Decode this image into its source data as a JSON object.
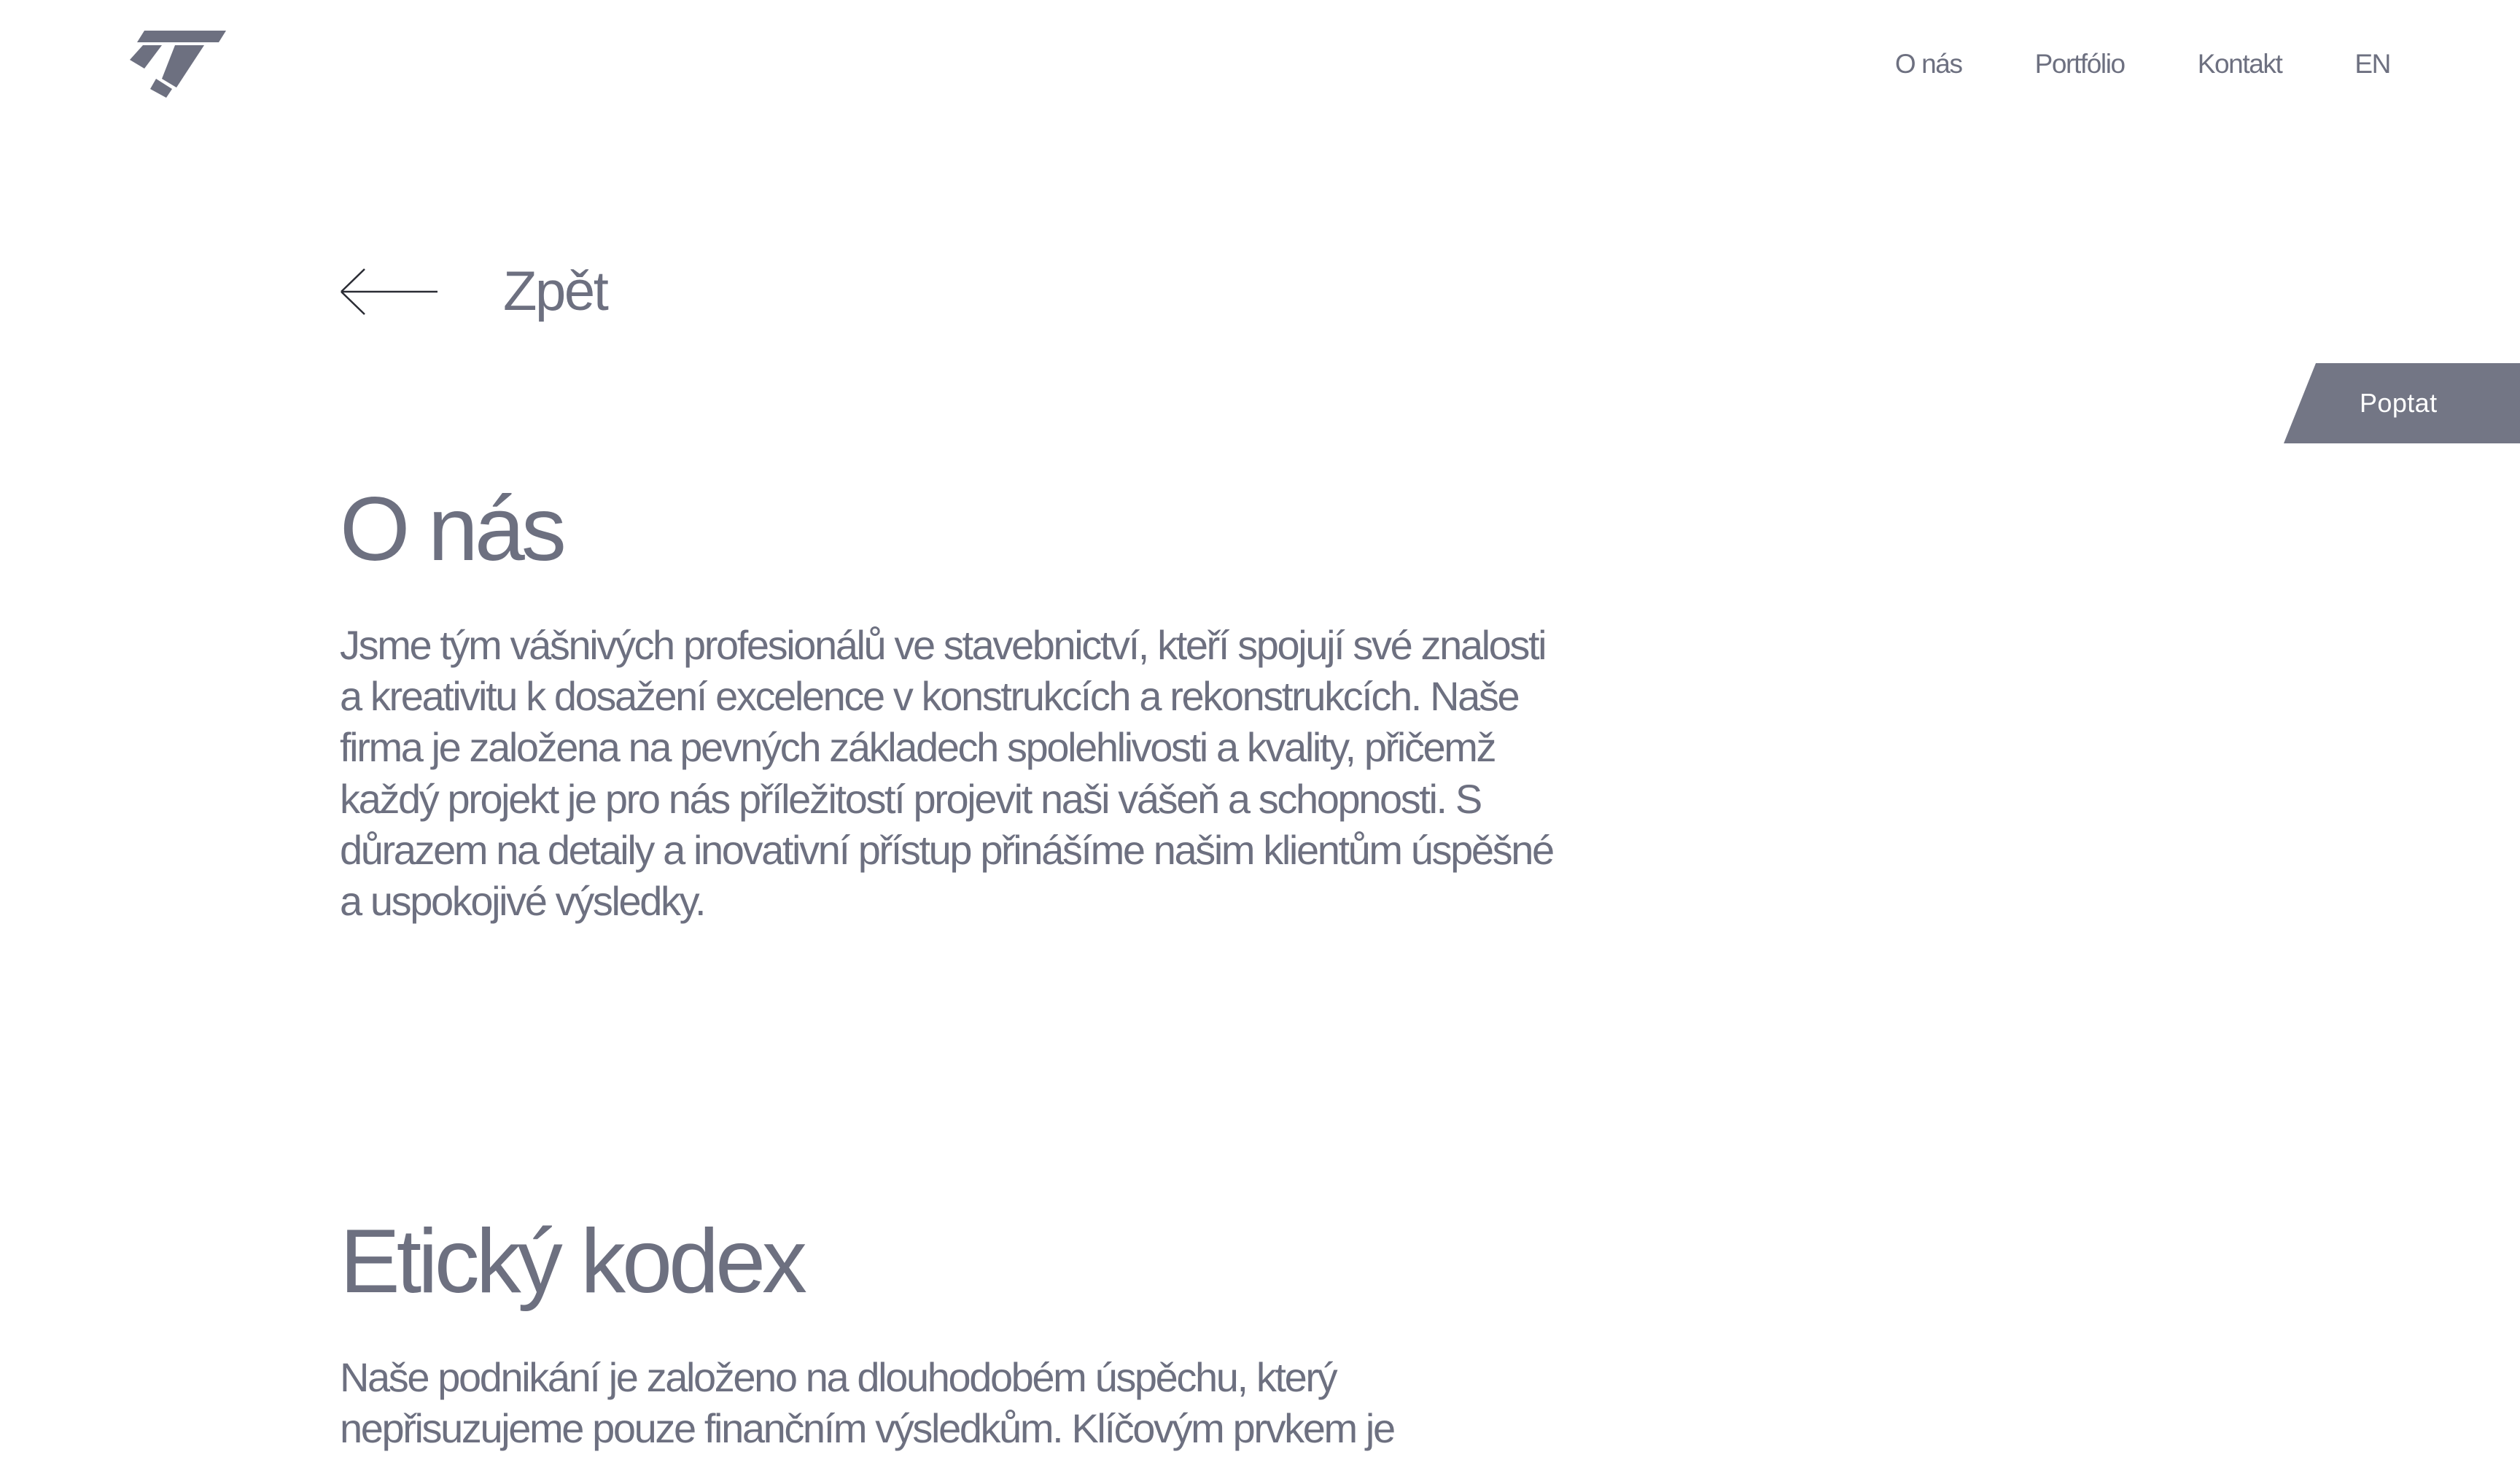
{
  "header": {
    "nav": [
      {
        "label": "O nás"
      },
      {
        "label": "Portfólio"
      },
      {
        "label": "Kontakt"
      },
      {
        "label": "EN"
      }
    ]
  },
  "back": {
    "label": "Zpět"
  },
  "inquiry": {
    "label": "Poptat"
  },
  "about": {
    "title": "O nás",
    "text": "Jsme tým vášnivých profesionálů ve stavebnictví, kteří spojují své znalosti a kreativitu k dosažení excelence v konstrukcích a rekonstrukcích. Naše firma je založena na pevných základech spolehlivosti a kvality, přičemž každý projekt je pro nás příležitostí projevit naši vášeň a schopnosti. S důrazem na detaily a inovativní přístup přinášíme našim klientům úspěšné a uspokojivé výsledky."
  },
  "ethics": {
    "title": "Etický kodex",
    "text": "Naše podnikání je založeno na dlouhodobém úspěchu, který nepřisuzujeme pouze finančním výsledkům. Klíčovým prvkem je"
  },
  "colors": {
    "text": "#6d7080",
    "button_bg": "#737685",
    "button_text": "#ffffff",
    "background": "#ffffff"
  },
  "icons": {
    "logo": "company-logo",
    "back": "arrow-left-icon"
  }
}
